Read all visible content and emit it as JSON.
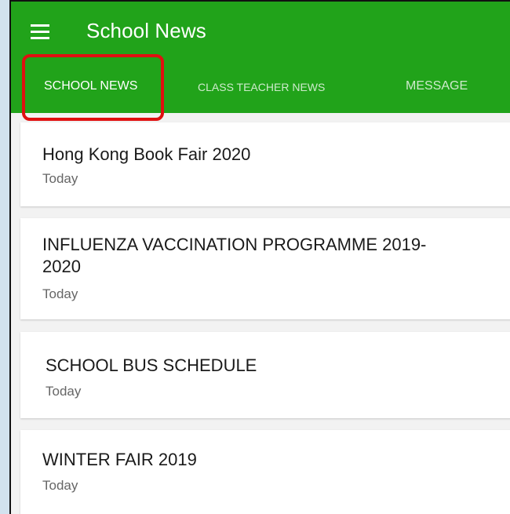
{
  "app": {
    "title": "School News",
    "accent_color": "#21a31a",
    "menu_icon": "hamburger-menu-icon"
  },
  "tabs": [
    {
      "label": "SCHOOL NEWS",
      "selected": true
    },
    {
      "label": "CLASS TEACHER NEWS",
      "selected": false
    },
    {
      "label": "MESSAGE",
      "selected": false
    }
  ],
  "highlight_color": "#e01010",
  "news": [
    {
      "title": "Hong Kong Book Fair 2020",
      "date": "Today"
    },
    {
      "title": "INFLUENZA VACCINATION PROGRAMME 2019-2020",
      "date": "Today"
    },
    {
      "title": "SCHOOL BUS SCHEDULE",
      "date": "Today"
    },
    {
      "title": "WINTER FAIR 2019",
      "date": "Today"
    }
  ]
}
